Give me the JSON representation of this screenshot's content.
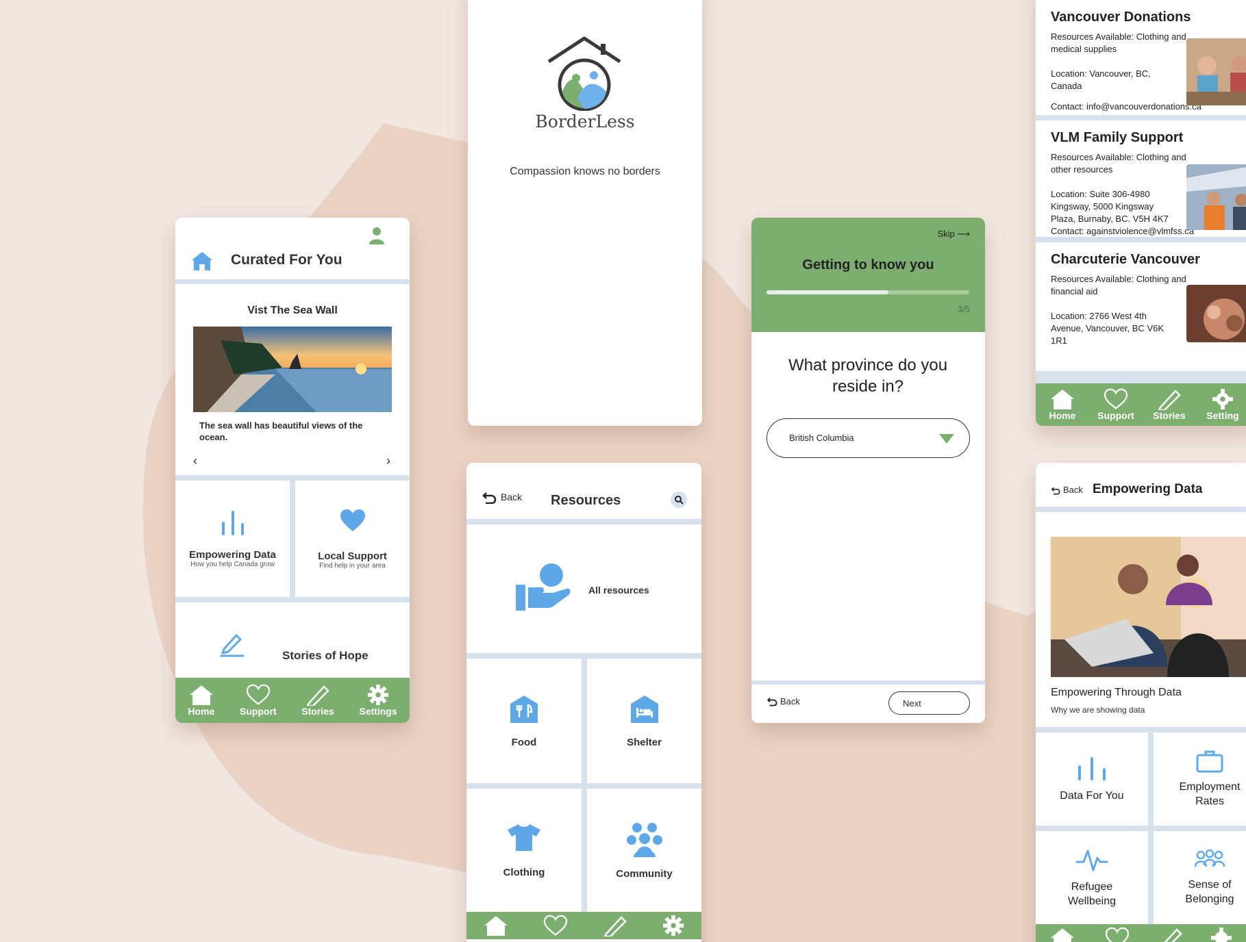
{
  "colors": {
    "background": "#f1e6e0",
    "blob": "#e9d2c4",
    "accent_blue": "#5fa8e8",
    "nav_green": "#7caf6f",
    "divider": "#d6e1ec"
  },
  "home": {
    "header_title": "Curated For You",
    "card_title": "Vist The Sea Wall",
    "card_caption": "The sea wall has beautiful views of the ocean.",
    "prev_arrow": "‹",
    "next_arrow": "›",
    "tile1_title": "Empowering Data",
    "tile1_sub": "How you help Canada grow",
    "tile2_title": "Local Support",
    "tile2_sub": "Find help in your area",
    "tile3_title": "Stories of Hope"
  },
  "nav": {
    "home": "Home",
    "support": "Support",
    "stories": "Stories",
    "settings": "Settings"
  },
  "splash": {
    "brand": "BorderLess",
    "tagline": "Compassion knows no borders"
  },
  "resources": {
    "back": "Back",
    "title": "Resources",
    "all": "All resources",
    "food": "Food",
    "shelter": "Shelter",
    "clothing": "Clothing",
    "community": "Community"
  },
  "onboarding": {
    "skip": "Skip",
    "title": "Getting to know you",
    "progress": 0.6,
    "step": "3/5",
    "question": "What province do you reside in?",
    "selected": "British Columbia",
    "back": "Back",
    "next": "Next"
  },
  "support_list": {
    "orgs": [
      {
        "name": "Vancouver Donations",
        "resources": "Resources Available: Clothing and medical supplies",
        "location": "Location: Vancouver, BC, Canada",
        "contact": "Contact: info@vancouverdonations.ca"
      },
      {
        "name": "VLM Family Support",
        "resources": "Resources Available: Clothing and other resources",
        "location": "Location: Suite 306-4980 Kingsway, 5000 Kingsway Plaza, Burnaby, BC. V5H 4K7",
        "contact": "Contact: againstviolence@vlmfss.ca"
      },
      {
        "name": "Charcuterie Vancouver",
        "resources": "Resources Available: Clothing and financial aid",
        "location": "Location: 2766 West 4th Avenue, Vancouver, BC V6K 1R1"
      }
    ],
    "nav_settings": "Setting"
  },
  "data_screen": {
    "back": "Back",
    "title": "Empowering Data",
    "hero_title": "Empowering Through Data",
    "hero_sub": "Why we are showing data",
    "t1": "Data For You",
    "t2": "Employment Rates",
    "t3": "Refugee Wellbeing",
    "t4": "Sense of Belonging"
  }
}
